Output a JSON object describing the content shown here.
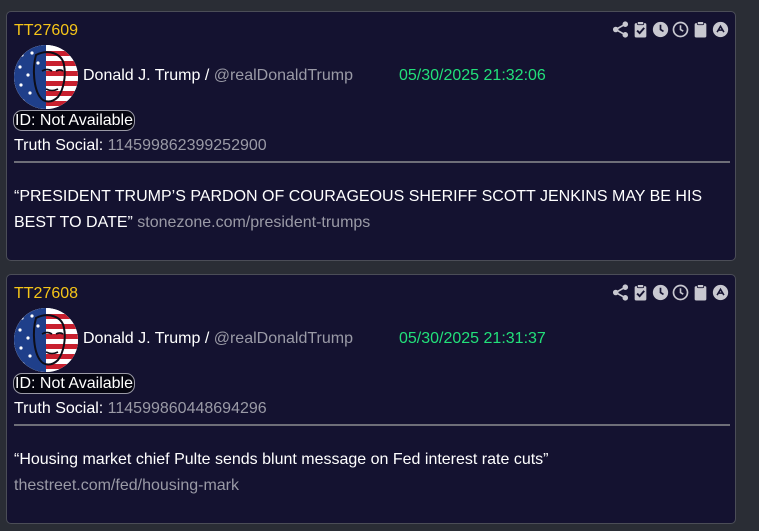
{
  "posts": [
    {
      "tt_id": "TT27609",
      "author_name": "Donald J. Trump /",
      "author_handle": "@realDonaldTrump",
      "timestamp": "05/30/2025 21:32:06",
      "id_label": "ID: Not Available",
      "truth_label": "Truth Social:",
      "truth_id": "114599862399252900",
      "text": "“PRESIDENT TRUMP’S PARDON OF COURAGEOUS SHERIFF SCOTT JENKINS MAY BE HIS BEST TO DATE”",
      "link": "stonezone.com/president-trumps"
    },
    {
      "tt_id": "TT27608",
      "author_name": "Donald J. Trump /",
      "author_handle": "@realDonaldTrump",
      "timestamp": "05/30/2025 21:31:37",
      "id_label": "ID: Not Available",
      "truth_label": "Truth Social:",
      "truth_id": "114599860448694296",
      "text": "“Housing market chief Pulte sends blunt message on Fed interest rate cuts”",
      "link": "thestreet.com/fed/housing-mark"
    }
  ],
  "toolbar_icons": [
    "share-icon",
    "clipboard-check-icon",
    "clock-icon",
    "clock-outline-icon",
    "clipboard-icon",
    "scroll-up-icon"
  ],
  "colors": {
    "tt_id": "#f5c518",
    "timestamp": "#22e07a",
    "card_bg": "#141230",
    "muted": "#9a9aa6"
  }
}
